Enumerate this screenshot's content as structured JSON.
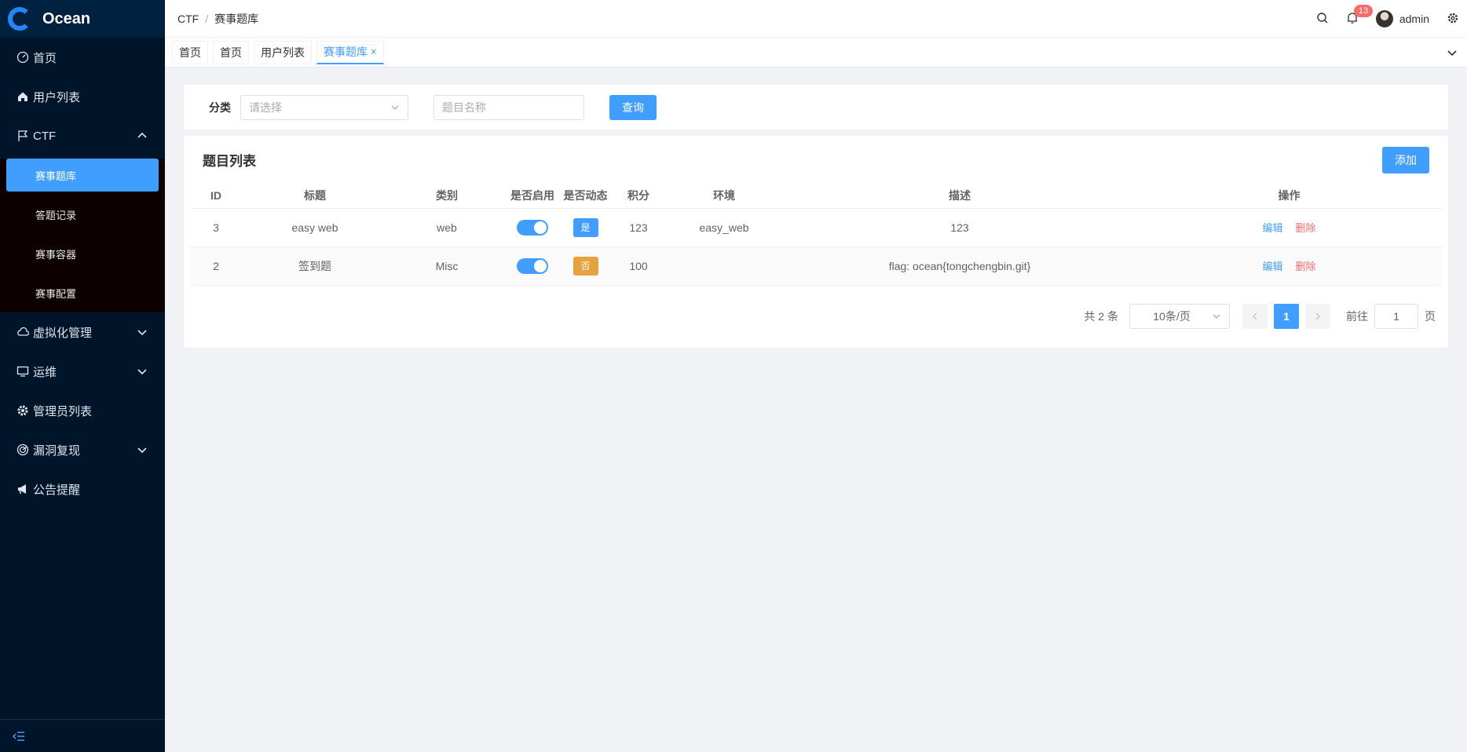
{
  "app": {
    "name": "Ocean"
  },
  "sidebar": {
    "items": [
      {
        "label": "首页",
        "icon": "dashboard-icon"
      },
      {
        "label": "用户列表",
        "icon": "home-icon"
      },
      {
        "label": "CTF",
        "icon": "flag-icon",
        "expanded": true,
        "children": [
          {
            "label": "赛事题库",
            "active": true
          },
          {
            "label": "答题记录"
          },
          {
            "label": "赛事容器"
          },
          {
            "label": "赛事配置"
          }
        ]
      },
      {
        "label": "虚拟化管理",
        "icon": "cloud-icon"
      },
      {
        "label": "运维",
        "icon": "monitor-icon"
      },
      {
        "label": "管理员列表",
        "icon": "gear-icon"
      },
      {
        "label": "漏洞复现",
        "icon": "radar-icon"
      },
      {
        "label": "公告提醒",
        "icon": "megaphone-icon"
      }
    ],
    "footer_icon": "collapse-menu-icon"
  },
  "header": {
    "breadcrumb": [
      "CTF",
      "赛事题库"
    ],
    "notification_count": "13",
    "user": "admin"
  },
  "tabs": [
    {
      "label": "首页"
    },
    {
      "label": "首页"
    },
    {
      "label": "用户列表"
    },
    {
      "label": "赛事题库",
      "active": true,
      "close": "×"
    }
  ],
  "filter": {
    "category_label": "分类",
    "category_placeholder": "请选择",
    "name_placeholder": "题目名称",
    "query_label": "查询"
  },
  "panel": {
    "title": "题目列表",
    "add_label": "添加",
    "columns": [
      "ID",
      "标题",
      "类别",
      "是否启用",
      "是否动态",
      "积分",
      "环境",
      "描述",
      "操作"
    ],
    "rows": [
      {
        "id": "3",
        "title": "easy web",
        "category": "web",
        "enabled": true,
        "dynamic": "是",
        "score": "123",
        "env": "easy_web",
        "desc": "123",
        "edit": "编辑",
        "delete": "删除"
      },
      {
        "id": "2",
        "title": "签到题",
        "category": "Misc",
        "enabled": true,
        "dynamic": "否",
        "score": "100",
        "env": "",
        "desc": "flag: ocean{tongchengbin.git}",
        "edit": "编辑",
        "delete": "删除"
      }
    ]
  },
  "pagination": {
    "total": "共 2 条",
    "page_size": "10条/页",
    "current": "1",
    "goto_label": "前往",
    "goto_value": "1",
    "page_suffix": "页"
  },
  "colors": {
    "primary": "#409eff",
    "danger": "#f56c6c",
    "warning": "#e6a23c",
    "sidebar": "#001529"
  }
}
